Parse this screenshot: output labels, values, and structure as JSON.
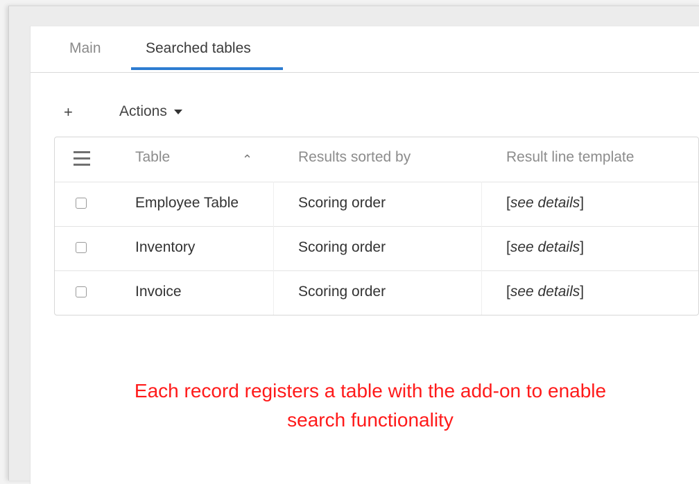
{
  "tabs": [
    {
      "label": "Main"
    },
    {
      "label": "Searched tables"
    }
  ],
  "toolbar": {
    "add_label": "+",
    "actions_label": "Actions"
  },
  "table": {
    "columns": [
      "Table",
      "Results sorted by",
      "Result line template"
    ],
    "rows": [
      {
        "table": "Employee Table",
        "sorted_by": "Scoring order",
        "template_prefix": "[",
        "template_link": "see details",
        "template_suffix": "]"
      },
      {
        "table": "Inventory",
        "sorted_by": "Scoring order",
        "template_prefix": "[",
        "template_link": "see details",
        "template_suffix": "]"
      },
      {
        "table": "Invoice",
        "sorted_by": "Scoring order",
        "template_prefix": "[",
        "template_link": "see details",
        "template_suffix": "]"
      }
    ]
  },
  "annotation": {
    "line1": "Each record registers a table with the add-on to enable",
    "line2": "search functionality"
  },
  "colors": {
    "accent": "#2d7cd1",
    "annotation": "#ff1a1a"
  },
  "icons": [
    "menu-icon",
    "sort-ascending-icon",
    "caret-down-icon",
    "add-icon"
  ]
}
